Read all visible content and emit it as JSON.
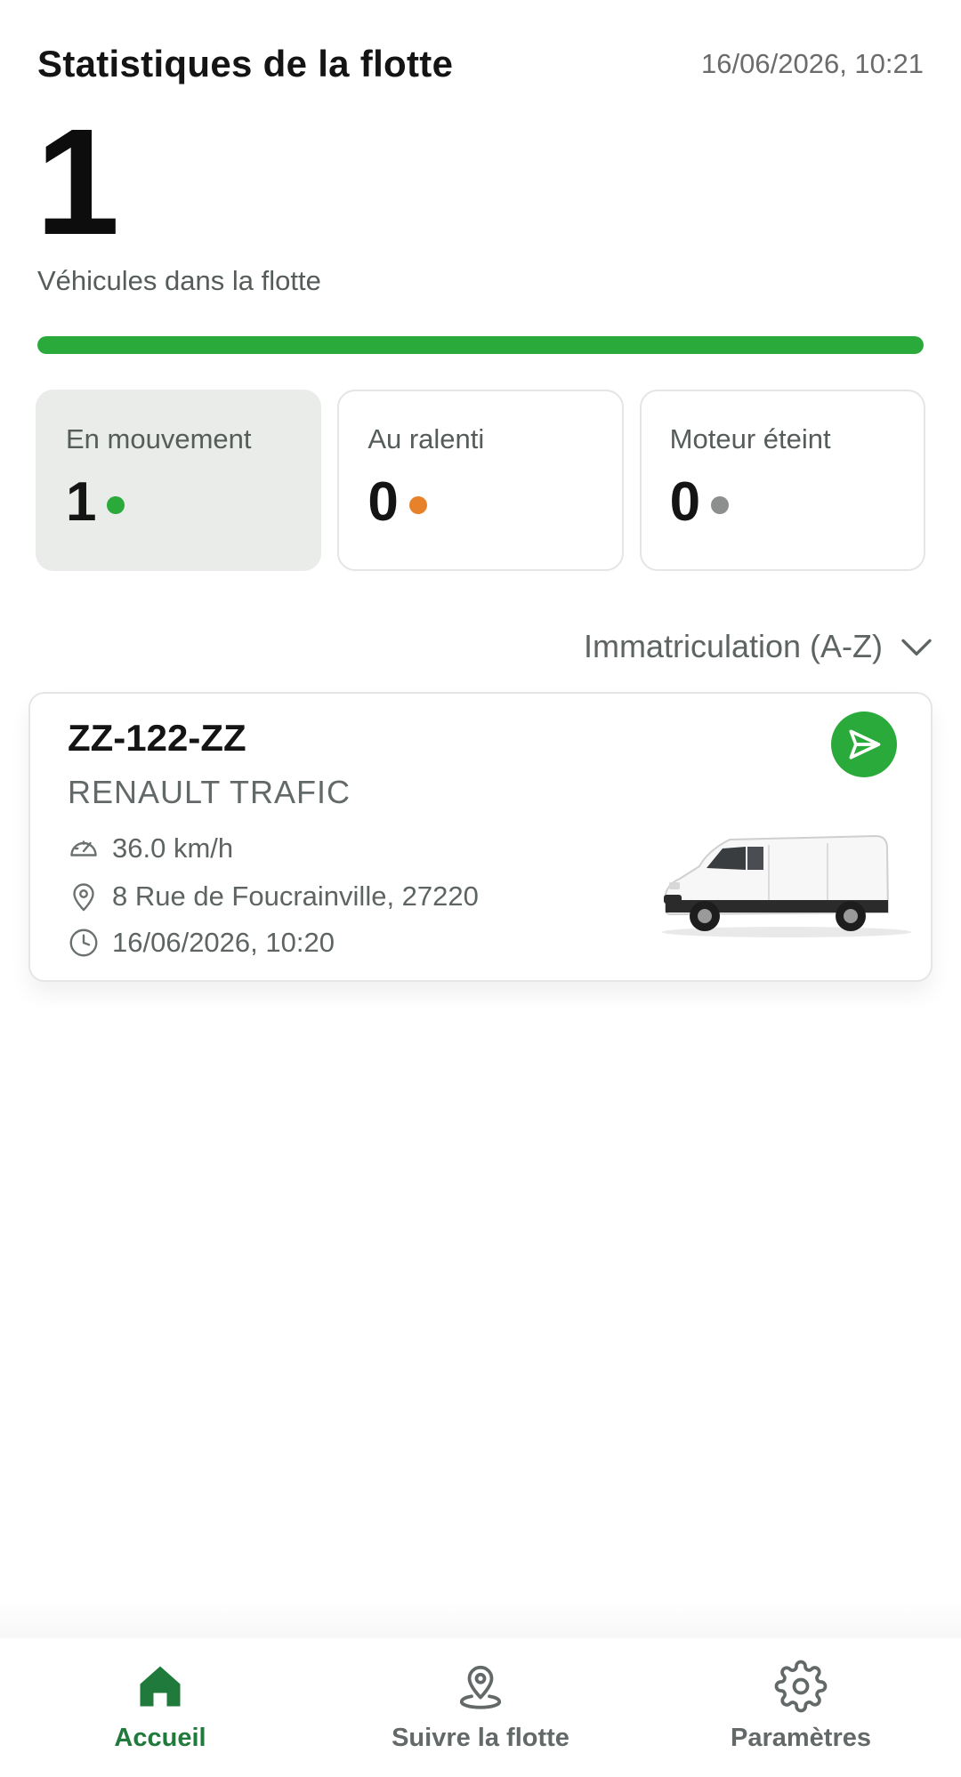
{
  "header": {
    "title": "Statistiques de la flotte",
    "timestamp": "16/06/2026, 10:21"
  },
  "fleet": {
    "total": "1",
    "total_label": "Véhicules dans la flotte",
    "moving_fraction": 1.0
  },
  "stats": [
    {
      "label": "En mouvement",
      "value": "1",
      "color": "#2aaa3a",
      "active": true
    },
    {
      "label": "Au ralenti",
      "value": "0",
      "color": "#e8822a",
      "active": false
    },
    {
      "label": "Moteur éteint",
      "value": "0",
      "color": "#8c8f8e",
      "active": false
    }
  ],
  "sort": {
    "label": "Immatriculation (A-Z)",
    "icon": "chevron-down-icon"
  },
  "vehicle": {
    "plate": "ZZ-122-ZZ",
    "model": "RENAULT TRAFIC",
    "speed": "36.0 km/h",
    "address": "8 Rue de Foucrainville, 27220",
    "timestamp": "16/06/2026, 10:20"
  },
  "nav": {
    "items": [
      {
        "label": "Accueil",
        "icon": "home-icon",
        "active": true
      },
      {
        "label": "Suivre la flotte",
        "icon": "map-pin-icon",
        "active": false
      },
      {
        "label": "Paramètres",
        "icon": "gear-icon",
        "active": false
      }
    ]
  },
  "colors": {
    "accent": "#2aaa3a",
    "nav_active": "#1f7a3b"
  }
}
